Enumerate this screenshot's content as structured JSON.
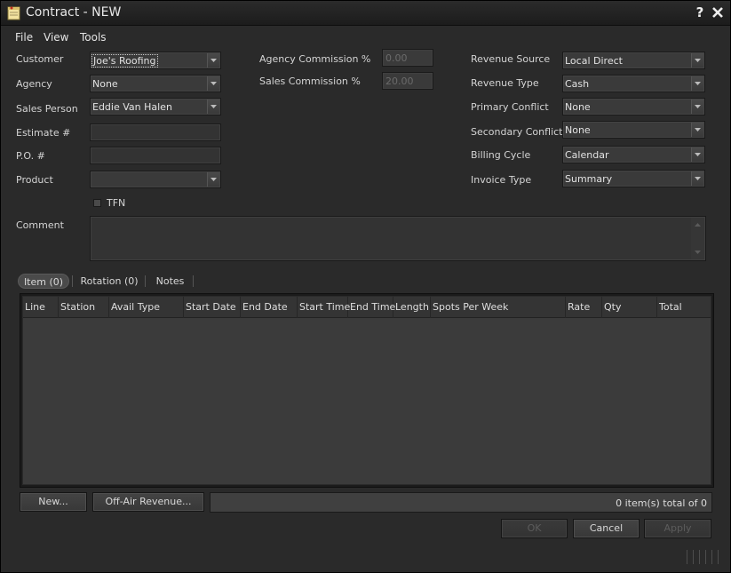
{
  "window": {
    "title": "Contract - NEW"
  },
  "menu": [
    "File",
    "View",
    "Tools"
  ],
  "form": {
    "customer": {
      "label": "Customer",
      "value": "Joe's Roofing"
    },
    "agency": {
      "label": "Agency",
      "value": "None"
    },
    "sales_person": {
      "label": "Sales Person",
      "value": "Eddie Van Halen"
    },
    "estimate": {
      "label": "Estimate #",
      "value": ""
    },
    "po": {
      "label": "P.O. #",
      "value": ""
    },
    "product": {
      "label": "Product",
      "value": ""
    },
    "tfn": {
      "label": "TFN",
      "checked": false
    },
    "comment": {
      "label": "Comment",
      "value": ""
    },
    "agency_commission": {
      "label": "Agency Commission %",
      "value": "0.00"
    },
    "sales_commission": {
      "label": "Sales Commission %",
      "value": "20.00"
    },
    "revenue_source": {
      "label": "Revenue Source",
      "value": "Local Direct"
    },
    "revenue_type": {
      "label": "Revenue Type",
      "value": "Cash"
    },
    "primary_conflict": {
      "label": "Primary Conflict",
      "value": "None"
    },
    "secondary_conflict": {
      "label": "Secondary Conflict",
      "value": "None"
    },
    "billing_cycle": {
      "label": "Billing Cycle",
      "value": "Calendar"
    },
    "invoice_type": {
      "label": "Invoice Type",
      "value": "Summary"
    }
  },
  "tabs": [
    {
      "label": "Item (0)",
      "active": true
    },
    {
      "label": "Rotation (0)",
      "active": false
    },
    {
      "label": "Notes",
      "active": false
    }
  ],
  "grid": {
    "columns": [
      "Line",
      "Station",
      "Avail Type",
      "Start Date",
      "End Date",
      "Start Time",
      "End Time",
      "Length",
      "Spots Per Week",
      "Rate",
      "Qty",
      "Total"
    ],
    "rows": []
  },
  "buttons": {
    "new": "New...",
    "off_air_revenue": "Off-Air Revenue...",
    "ok": "OK",
    "cancel": "Cancel",
    "apply": "Apply"
  },
  "status": "0 item(s) total of 0",
  "colors": {
    "background": "#2a2a2a",
    "field": "#333333",
    "text": "#d8d8d8"
  }
}
